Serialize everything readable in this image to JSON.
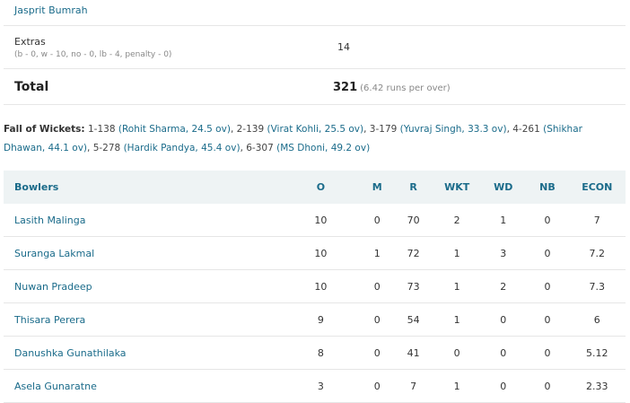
{
  "batting": {
    "last_player": "Jasprit Bumrah",
    "extras_label": "Extras",
    "extras_detail": "(b - 0, w - 10, no - 0, lb - 4, penalty - 0)",
    "extras_value": "14",
    "total_label": "Total",
    "total_value": "321",
    "total_rate": "(6.42 runs per over)"
  },
  "fall_of_wickets": {
    "title": "Fall of Wickets:",
    "entries": [
      {
        "score": "1-138",
        "player": "Rohit Sharma",
        "over": "24.5 ov"
      },
      {
        "score": "2-139",
        "player": "Virat Kohli",
        "over": "25.5 ov"
      },
      {
        "score": "3-179",
        "player": "Yuvraj Singh",
        "over": "33.3 ov"
      },
      {
        "score": "4-261",
        "player": "Shikhar Dhawan",
        "over": "44.1 ov"
      },
      {
        "score": "5-278",
        "player": "Hardik Pandya",
        "over": "45.4 ov"
      },
      {
        "score": "6-307",
        "player": "MS Dhoni",
        "over": "49.2 ov"
      }
    ]
  },
  "bowling": {
    "headers": [
      "Bowlers",
      "O",
      "M",
      "R",
      "WKT",
      "WD",
      "NB",
      "ECON"
    ],
    "rows": [
      {
        "name": "Lasith Malinga",
        "o": "10",
        "m": "0",
        "r": "70",
        "wkt": "2",
        "wd": "1",
        "nb": "0",
        "econ": "7"
      },
      {
        "name": "Suranga Lakmal",
        "o": "10",
        "m": "1",
        "r": "72",
        "wkt": "1",
        "wd": "3",
        "nb": "0",
        "econ": "7.2"
      },
      {
        "name": "Nuwan Pradeep",
        "o": "10",
        "m": "0",
        "r": "73",
        "wkt": "1",
        "wd": "2",
        "nb": "0",
        "econ": "7.3"
      },
      {
        "name": "Thisara Perera",
        "o": "9",
        "m": "0",
        "r": "54",
        "wkt": "1",
        "wd": "0",
        "nb": "0",
        "econ": "6"
      },
      {
        "name": "Danushka Gunathilaka",
        "o": "8",
        "m": "0",
        "r": "41",
        "wkt": "0",
        "wd": "0",
        "nb": "0",
        "econ": "5.12"
      },
      {
        "name": "Asela Gunaratne",
        "o": "3",
        "m": "0",
        "r": "7",
        "wkt": "1",
        "wd": "0",
        "nb": "0",
        "econ": "2.33"
      }
    ]
  },
  "colors": {
    "link": "#1a6b8a",
    "header_bg": "#eef3f4",
    "divider": "#e6e6e6"
  }
}
